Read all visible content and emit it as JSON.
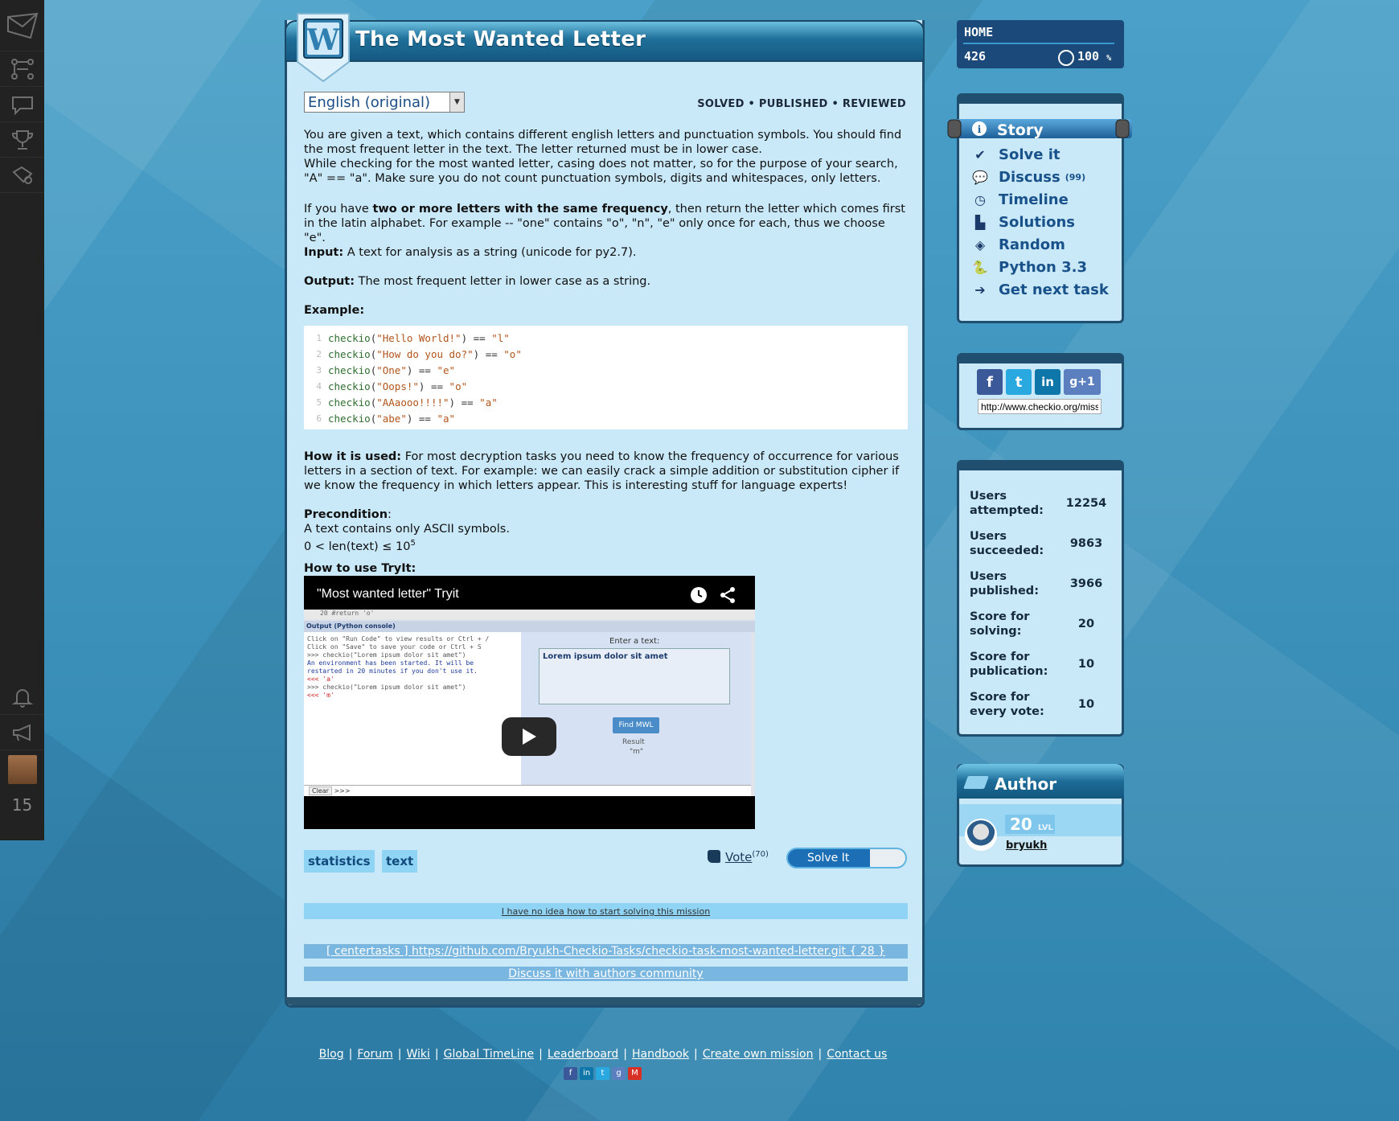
{
  "left_nav": {
    "items": [
      "mail-icon",
      "sitemap-icon",
      "chat-icon",
      "trophy-icon",
      "award-icon"
    ],
    "bottom_items": [
      "bell-icon",
      "megaphone-icon"
    ],
    "counter": "15"
  },
  "mission": {
    "title": "The Most Wanted Letter",
    "badge_letter": "W",
    "language_select": "English (original)",
    "status": "SOLVED • PUBLISHED • REVIEWED",
    "intro_1": "You are given a text, which contains different english letters and punctuation symbols. You should find the most frequent letter in the text. The letter returned must be in lower case.",
    "intro_2": "While checking for the most wanted letter, casing does not matter, so for the purpose of your search, \"A\" == \"a\". Make sure you do not count punctuation symbols, digits and whitespaces, only letters.",
    "tie_prefix": "If you have ",
    "tie_bold": "two or more letters with the same frequency",
    "tie_rest": ", then return the letter which comes first in the latin alphabet. For example -- \"one\" contains \"o\", \"n\", \"e\" only once for each, thus we choose \"e\".",
    "input_label": "Input:",
    "input_text": " A text for analysis as a string (unicode for py2.7).",
    "output_label": "Output:",
    "output_text": " The most frequent letter in lower case as a string.",
    "example_label": "Example:",
    "code_lines": [
      {
        "n": "1",
        "fn": "checkio",
        "arg": "\"Hello World!\"",
        "res": "\"l\""
      },
      {
        "n": "2",
        "fn": "checkio",
        "arg": "\"How do you do?\"",
        "res": "\"o\""
      },
      {
        "n": "3",
        "fn": "checkio",
        "arg": "\"One\"",
        "res": "\"e\""
      },
      {
        "n": "4",
        "fn": "checkio",
        "arg": "\"Oops!\"",
        "res": "\"o\""
      },
      {
        "n": "5",
        "fn": "checkio",
        "arg": "\"AAaooo!!!!\"",
        "res": "\"a\""
      },
      {
        "n": "6",
        "fn": "checkio",
        "arg": "\"abe\"",
        "res": "\"a\""
      }
    ],
    "how_used_label": "How it is used:",
    "how_used_text": " For most decryption tasks you need to know the frequency of occurrence for various letters in a section of text. For example: we can easily crack a simple addition or substitution cipher if we know the frequency in which letters appear. This is interesting stuff for language experts!",
    "precondition_label": "Precondition",
    "precondition_line1": "A text contains only ASCII symbols.",
    "precondition_line2": "0 < len(text) ≤ 10",
    "precondition_exp": "5",
    "tryit_label": "How to use TryIt:",
    "video_title": "\"Most wanted letter\" Tryit",
    "video_console_header": "Output (Python console)",
    "video_console_lines": [
      "Click on \"Run Code\" to view results or Ctrl + /",
      "Click on \"Save\" to save your code or Ctrl + S",
      ">>> checkio(\"Lorem ipsum dolor sit amet\")",
      "An environment has been started. It will be",
      "restarted in 20 minutes if you don't use it.",
      "<<< 'a'",
      ">>> checkio(\"Lorem ipsum dolor sit amet\")",
      "<<< 'm'"
    ],
    "video_enter_label": "Enter a text:",
    "video_text_value": "Lorem ipsum dolor sit amet",
    "video_button": "Find MWL",
    "video_result_label": "Result",
    "video_result_value": "\"m\"",
    "video_code_line": "20      #return 'o'",
    "video_clear": "Clear",
    "video_prompt": ">>>",
    "tags": [
      "statistics",
      "text"
    ],
    "vote_label": "Vote",
    "vote_count": "(70)",
    "solve_button": "Solve It",
    "hint_link": "I have no idea how to start solving this mission",
    "github_link": "[ centertasks ] https://github.com/Bryukh-Checkio-Tasks/checkio-task-most-wanted-letter.git { 28 }",
    "discuss_link": "Discuss it with authors community"
  },
  "footer": {
    "links": [
      "Blog",
      "Forum",
      "Wiki",
      "Global TimeLine",
      "Leaderboard",
      "Handbook",
      "Create own mission",
      "Contact us"
    ],
    "icons": [
      "facebook-icon",
      "linkedin-icon",
      "twitter-icon",
      "googleplus-icon",
      "gmail-icon"
    ]
  },
  "home": {
    "title": "HOME",
    "score": "426",
    "percent": "100",
    "percent_sign": "%"
  },
  "story_menu": {
    "header": "Story",
    "items": [
      {
        "label": "Solve it",
        "icon": "check-icon"
      },
      {
        "label": "Discuss",
        "count": "(99)",
        "icon": "speech-bubble-icon"
      },
      {
        "label": "Timeline",
        "icon": "clock-icon"
      },
      {
        "label": "Solutions",
        "icon": "podium-icon"
      },
      {
        "label": "Random",
        "icon": "cube-icon"
      },
      {
        "label": "Python 3.3",
        "icon": "python-icon"
      },
      {
        "label": "Get next task",
        "icon": "arrow-right-icon"
      }
    ]
  },
  "share": {
    "url": "http://www.checkio.org/mission/most-wanted-letter/",
    "icons": [
      {
        "name": "facebook-share-icon",
        "glyph": "f",
        "color": "#3b5998"
      },
      {
        "name": "twitter-share-icon",
        "glyph": "t",
        "color": "#2aa9e0"
      },
      {
        "name": "linkedin-share-icon",
        "glyph": "in",
        "color": "#0e76a8"
      },
      {
        "name": "googleplus-share-icon",
        "glyph": "g+1",
        "color": "#5b7fbf"
      }
    ]
  },
  "stats": [
    {
      "label": "Users attempted:",
      "value": "12254"
    },
    {
      "label": "Users succeeded:",
      "value": "9863"
    },
    {
      "label": "Users published:",
      "value": "3966"
    },
    {
      "label": "Score for solving:",
      "value": "20"
    },
    {
      "label": "Score for publication:",
      "value": "10"
    },
    {
      "label": "Score for every vote:",
      "value": "10"
    }
  ],
  "author": {
    "header": "Author",
    "level": "20",
    "level_suffix": "LVL",
    "name": "bryukh"
  },
  "colors": {
    "panel_bg": "#c9e8f8",
    "panel_border": "#1f4e6e",
    "accent_blue": "#19528a",
    "tag_bg": "#8fd3f5"
  }
}
